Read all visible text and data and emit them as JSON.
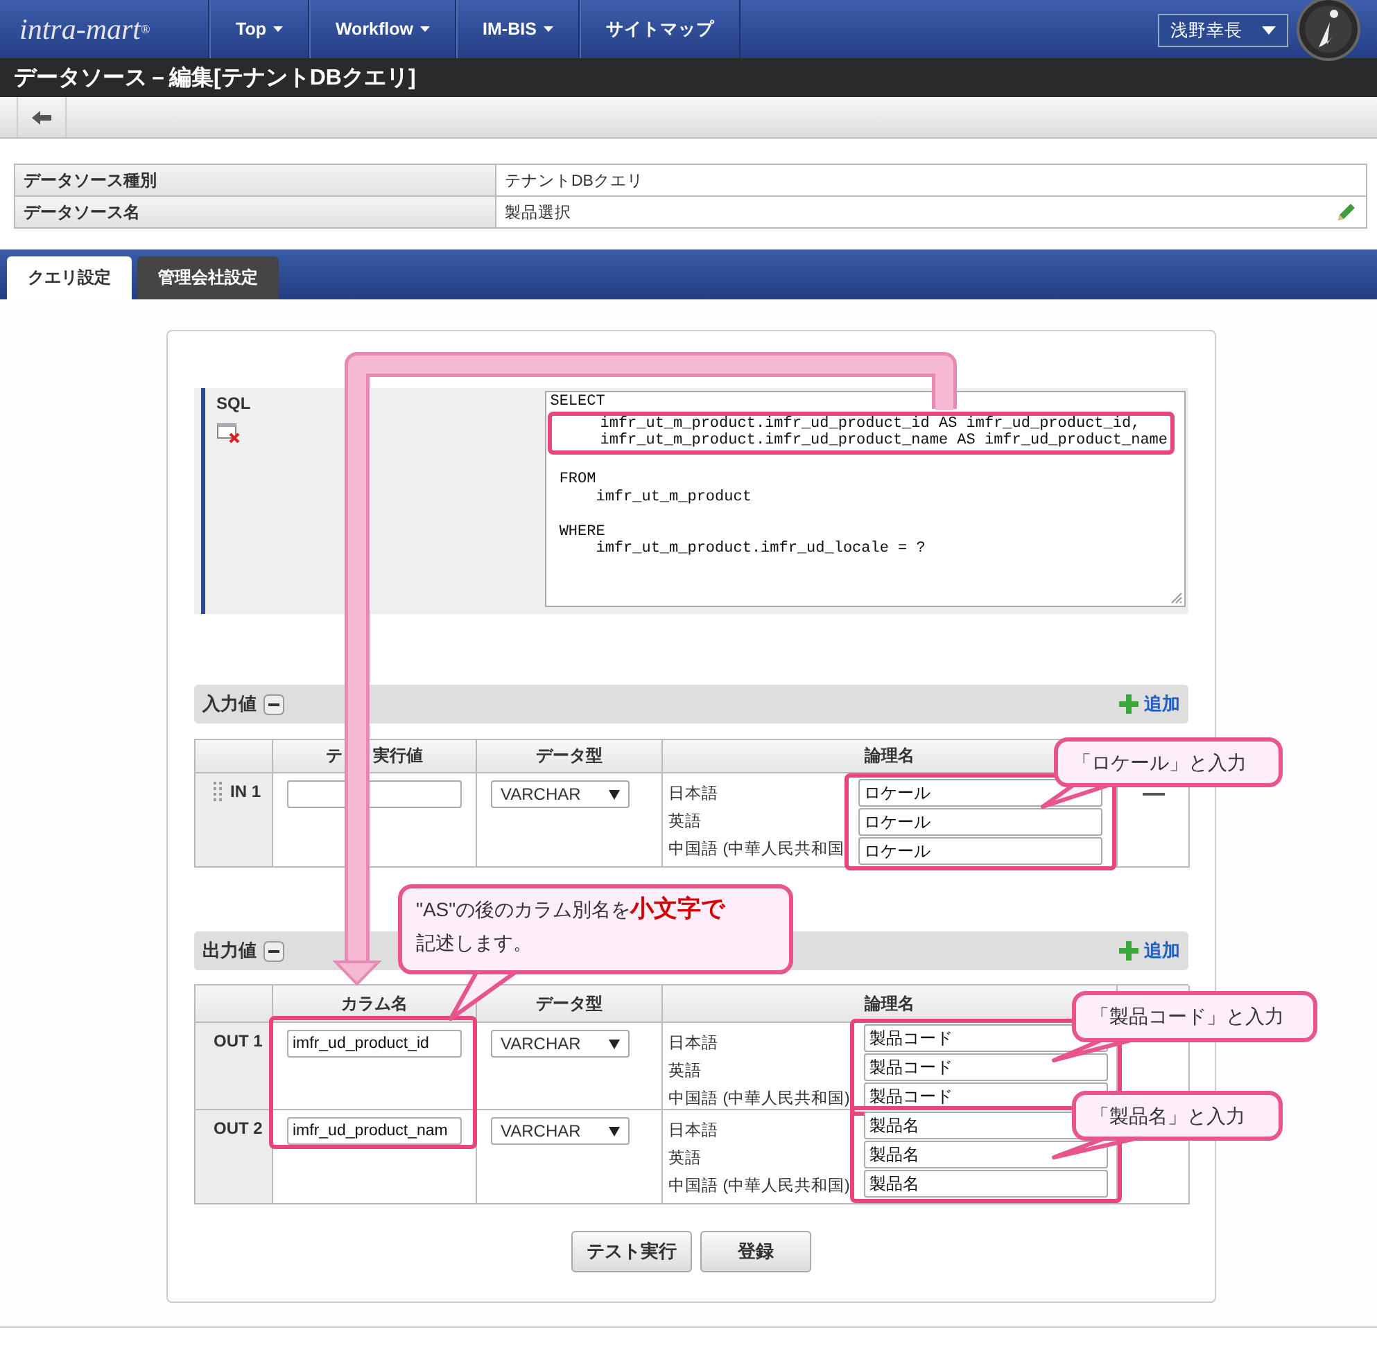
{
  "header": {
    "logo": "intra-mart$^{®}$",
    "nav": [
      {
        "label": "Top",
        "dropdown": true
      },
      {
        "label": "Workflow",
        "dropdown": true
      },
      {
        "label": "IM-BIS",
        "dropdown": true
      },
      {
        "label": "サイトマップ",
        "dropdown": false
      }
    ],
    "user": "浅野幸長"
  },
  "page_title": "データソース－編集[テナントDBクエリ]",
  "info": [
    {
      "label": "データソース種別",
      "value": "テナントDBクエリ",
      "editable": false
    },
    {
      "label": "データソース名",
      "value": "製品選択",
      "editable": true
    }
  ],
  "tabs": [
    {
      "label": "クエリ設定",
      "selected": true
    },
    {
      "label": "管理会社設定",
      "selected": false
    }
  ],
  "sql": {
    "label": "SQL",
    "blocks": [
      [
        "SELECT",
        "     imfr_ut_m_product.imfr_ud_product_id AS imfr_ud_product_id,",
        "     imfr_ut_m_product.imfr_ud_product_name AS imfr_ud_product_name"
      ],
      [
        " FROM",
        "     imfr_ut_m_product"
      ],
      [
        " WHERE",
        "     imfr_ut_m_product.imfr_ud_locale = ?"
      ]
    ]
  },
  "inputs": {
    "title": "入力値",
    "add": "追加",
    "columns": [
      [
        "テ",
        "実行値"
      ],
      [
        "データ型"
      ],
      [
        "論理名"
      ]
    ],
    "rows": [
      {
        "label": "IN 1",
        "type": "VARCHAR",
        "names": [
          {
            "lang": "日本語",
            "value": "ロケール"
          },
          {
            "lang": "英語",
            "value": "ロケール"
          },
          {
            "lang": "中国語 (中華人民共和国",
            "value": "ロケール"
          }
        ]
      }
    ]
  },
  "outputs": {
    "title": "出力値",
    "add": "追加",
    "columns": [
      [
        "カラム名"
      ],
      [
        "データ型"
      ],
      [
        "論理名"
      ]
    ],
    "rows": [
      {
        "label": "OUT 1",
        "column": "imfr_ud_product_id",
        "type": "VARCHAR",
        "names": [
          {
            "lang": "日本語",
            "value": "製品コード"
          },
          {
            "lang": "英語",
            "value": "製品コード"
          },
          {
            "lang": "中国語 (中華人民共和国)",
            "value": "製品コード"
          }
        ]
      },
      {
        "label": "OUT 2",
        "column": "imfr_ud_product_nam",
        "type": "VARCHAR",
        "names": [
          {
            "lang": "日本語",
            "value": "製品名"
          },
          {
            "lang": "英語",
            "value": "製品名"
          },
          {
            "lang": "中国語 (中華人民共和国)",
            "value": "製品名"
          }
        ]
      }
    ]
  },
  "buttons": [
    "テスト実行",
    "登録"
  ],
  "callouts": [
    {
      "lines": [
        "「ロケール」と入力"
      ]
    },
    {
      "lines": [
        "\"AS\"の後のカラム別名を**小文字で**",
        "記述します。"
      ]
    },
    {
      "lines": [
        "「製品コード」と入力"
      ]
    },
    {
      "lines": [
        "「製品名」と入力"
      ]
    }
  ]
}
